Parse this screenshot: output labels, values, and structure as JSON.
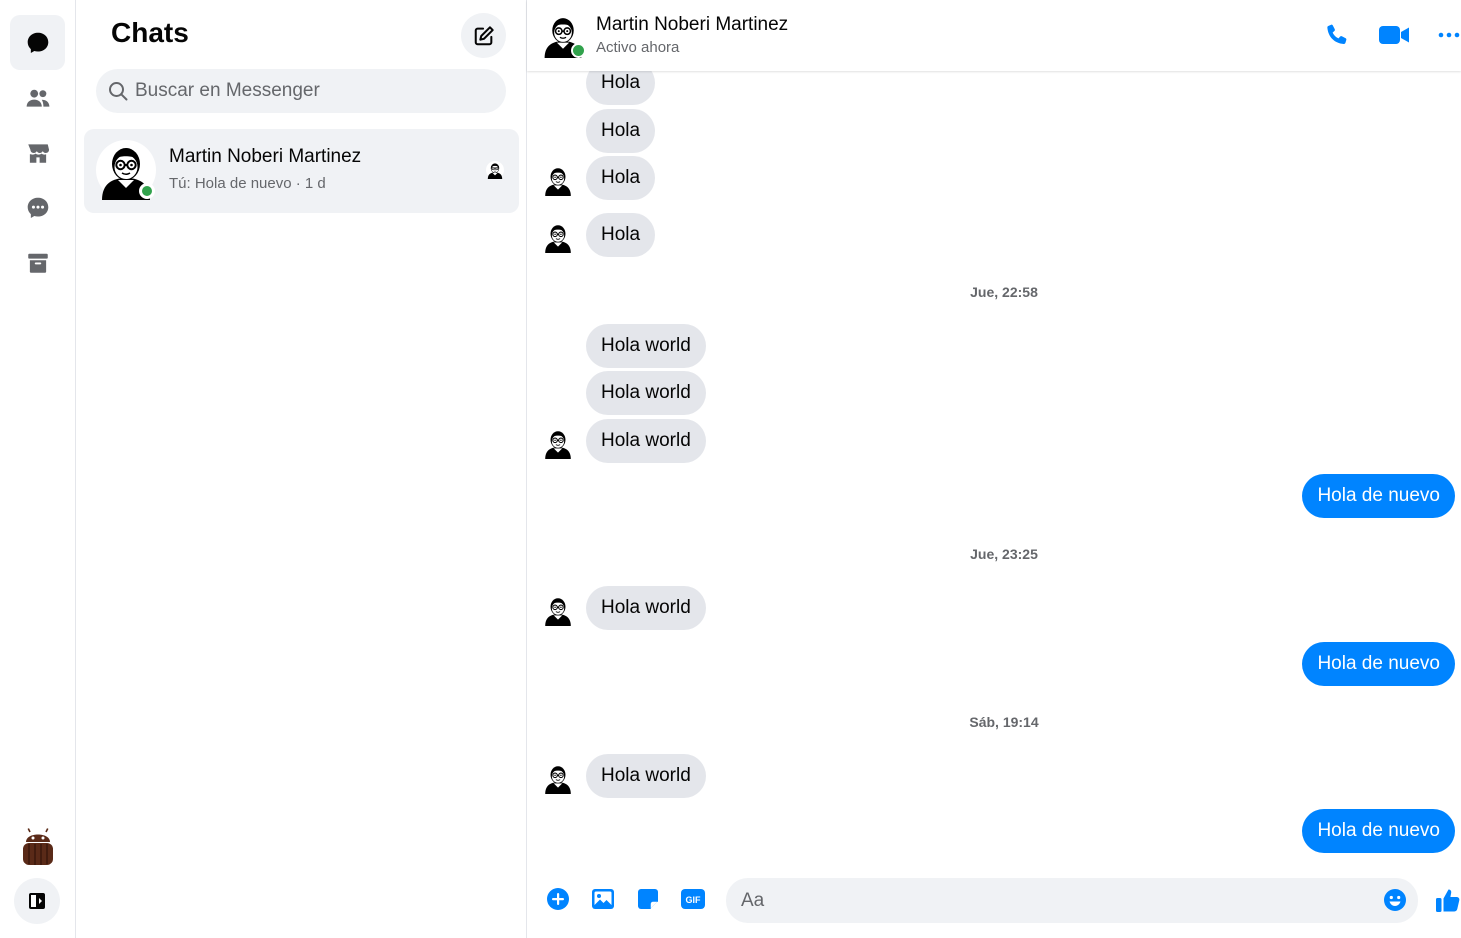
{
  "rail": {
    "items": [
      {
        "name": "chats",
        "icon": "chat-bubble-icon",
        "active": true
      },
      {
        "name": "people",
        "icon": "people-icon",
        "active": false
      },
      {
        "name": "marketplace",
        "icon": "store-icon",
        "active": false
      },
      {
        "name": "requests",
        "icon": "message-requests-icon",
        "active": false
      },
      {
        "name": "archived",
        "icon": "archive-icon",
        "active": false
      }
    ],
    "profile_icon": "android-avatar-icon",
    "collapse_icon": "sidebar-toggle-icon"
  },
  "list": {
    "title": "Chats",
    "search_placeholder": "Buscar en Messenger",
    "conversations": [
      {
        "name": "Martin Noberi Martinez",
        "preview": "Tú: Hola de nuevo · 1 d",
        "online": true
      }
    ]
  },
  "conversation": {
    "name": "Martin Noberi Martinez",
    "status": "Activo ahora",
    "messages": [
      {
        "from": "them",
        "text": "Hola"
      },
      {
        "from": "them",
        "text": "Hola"
      },
      {
        "from": "them",
        "text": "Hola"
      },
      {
        "from": "them",
        "text": "Hola"
      },
      {
        "type": "timestamp",
        "text": "Jue, 22:58"
      },
      {
        "from": "them",
        "text": "Hola world"
      },
      {
        "from": "them",
        "text": "Hola world"
      },
      {
        "from": "them",
        "text": "Hola world"
      },
      {
        "from": "me",
        "text": "Hola de nuevo"
      },
      {
        "type": "timestamp",
        "text": "Jue, 23:25"
      },
      {
        "from": "them",
        "text": "Hola world"
      },
      {
        "from": "me",
        "text": "Hola de nuevo"
      },
      {
        "type": "timestamp",
        "text": "Sáb, 19:14"
      },
      {
        "from": "them",
        "text": "Hola world"
      },
      {
        "from": "me",
        "text": "Hola de nuevo"
      }
    ],
    "composer": {
      "placeholder": "Aa",
      "gif_label": "GIF"
    }
  },
  "colors": {
    "accent": "#0084ff",
    "online": "#31a24c",
    "bubble_in": "#e4e6eb",
    "panel_bg": "#f0f2f5"
  }
}
